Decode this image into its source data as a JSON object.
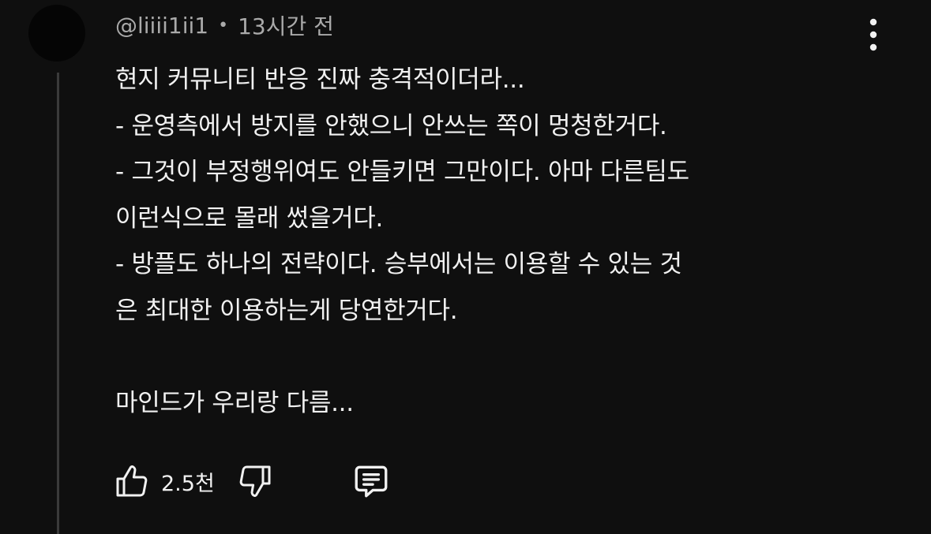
{
  "comment": {
    "author": "@liiii1ii1",
    "separator": "•",
    "timestamp": "13시간 전",
    "body": "현지 커뮤니티 반응 진짜 충격적이더라...\n- 운영측에서 방지를 안했으니 안쓰는 쪽이 멍청한거다.\n- 그것이 부정행위여도 안들키면 그만이다. 아마 다른팀도\n이런식으로 몰래 썼을거다.\n- 방플도 하나의 전략이다. 승부에서는 이용할 수 있는 것\n은 최대한 이용하는게 당연한거다.\n\n마인드가 우리랑 다름..."
  },
  "actions": {
    "like_count": "2.5천"
  },
  "icons": {
    "more": "more-vert-icon",
    "like": "thumb-up-icon",
    "dislike": "thumb-down-icon",
    "reply": "comment-icon"
  },
  "colors": {
    "background": "#0f0f0f",
    "text": "#f1f1f1",
    "secondary_text": "#aaaaaa",
    "thread_line": "#3a3a3a"
  }
}
